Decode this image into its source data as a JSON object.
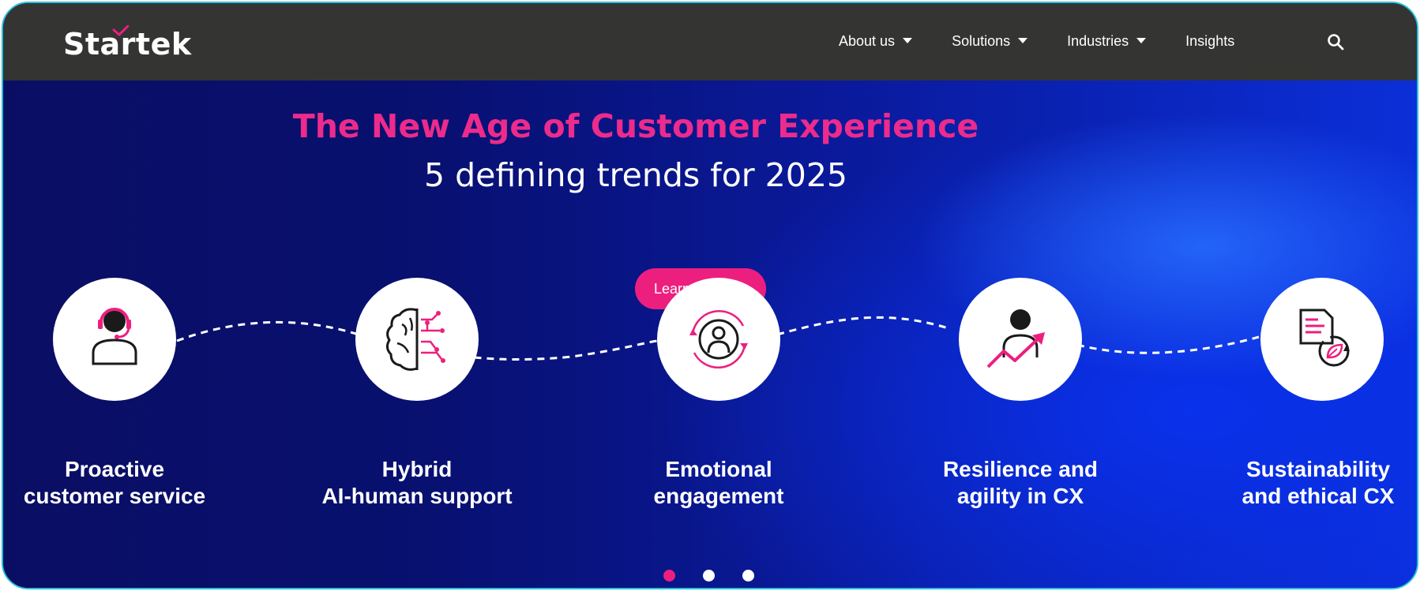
{
  "brand": {
    "logo_text": "Startek",
    "accent": "#ec1f7f",
    "nav_bg": "#343433",
    "hero_bg": "#0a1a9c"
  },
  "nav": {
    "items": [
      {
        "label": "About us",
        "has_dropdown": true
      },
      {
        "label": "Solutions",
        "has_dropdown": true
      },
      {
        "label": "Industries",
        "has_dropdown": true
      },
      {
        "label": "Insights",
        "has_dropdown": false
      }
    ],
    "search_icon": "search-icon"
  },
  "hero": {
    "title": "The New Age of Customer Experience",
    "subtitle": "5 defining trends for 2025",
    "cta_label": "Learn more",
    "trends": [
      {
        "line1": "Proactive",
        "line2": "customer service",
        "icon": "headset-agent-icon"
      },
      {
        "line1": "Hybrid",
        "line2": "AI-human support",
        "icon": "brain-circuit-icon"
      },
      {
        "line1": "Emotional",
        "line2": "engagement",
        "icon": "person-cycle-icon"
      },
      {
        "line1": "Resilience and",
        "line2": "agility in CX",
        "icon": "person-growth-icon"
      },
      {
        "line1": "Sustainability",
        "line2": "and ethical CX",
        "icon": "document-leaf-icon"
      }
    ]
  },
  "carousel": {
    "slide_count": 3,
    "active_index": 0
  }
}
